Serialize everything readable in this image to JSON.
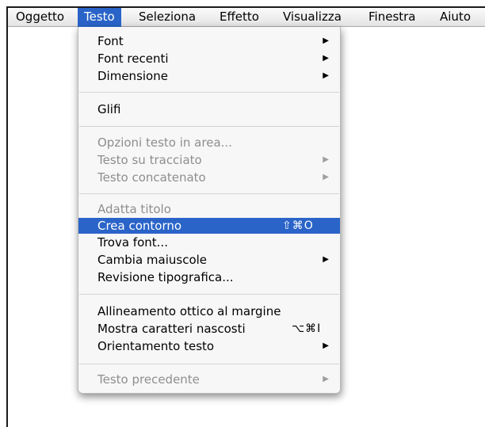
{
  "menubar": {
    "items": [
      "Oggetto",
      "Testo",
      "Seleziona",
      "Effetto",
      "Visualizza",
      "Finestra",
      "Aiuto"
    ]
  },
  "menu": {
    "font": "Font",
    "font_recenti": "Font recenti",
    "dimensione": "Dimensione",
    "glifi": "Glifi",
    "opzioni_testo": "Opzioni testo in area...",
    "testo_su_tracciato": "Testo su tracciato",
    "testo_concatenato": "Testo concatenato",
    "adatta_titolo": "Adatta titolo",
    "crea_contorno": "Crea contorno",
    "crea_contorno_shortcut": "⇧⌘O",
    "trova_font": "Trova font...",
    "cambia_maiuscole": "Cambia maiuscole",
    "revisione": "Revisione tipografica...",
    "allineamento": "Allineamento ottico al margine",
    "mostra_caratteri": "Mostra caratteri nascosti",
    "mostra_caratteri_shortcut": "⌥⌘I",
    "orientamento": "Orientamento testo",
    "testo_precedente": "Testo precedente"
  },
  "icons": {
    "submenu_arrow": "▶"
  },
  "colors": {
    "highlight": "#2a64c8",
    "disabled_text": "#8e8e8e"
  }
}
